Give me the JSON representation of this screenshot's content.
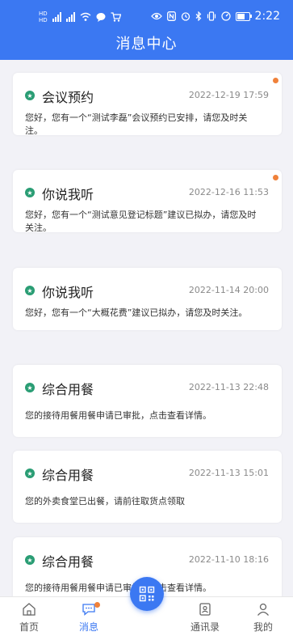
{
  "status": {
    "time": "2:22",
    "left_labels": [
      "HD",
      "HD"
    ],
    "icons": [
      "signal-icon",
      "wifi-icon",
      "message-icon",
      "cart-icon",
      "eye-icon",
      "nfc-icon",
      "alarm-icon",
      "bluetooth-icon",
      "vibrate-icon",
      "speed-icon",
      "battery-icon"
    ]
  },
  "header": {
    "title": "消息中心"
  },
  "messages": [
    {
      "title": "会议预约",
      "date": "2022-12-19 17:59",
      "body": "您好，您有一个“测试李磊”会议预约已安排，请您及时关注。",
      "unread": true
    },
    {
      "title": "你说我听",
      "date": "2022-12-16 11:53",
      "body": "您好，您有一个“测试意见登记标题”建议已拟办，请您及时关注。",
      "unread": true
    },
    {
      "title": "你说我听",
      "date": "2022-11-14 20:00",
      "body": "您好，您有一个“大概花费”建议已拟办，请您及时关注。",
      "unread": false
    },
    {
      "title": "综合用餐",
      "date": "2022-11-13 22:48",
      "body": "您的接待用餐用餐申请已审批，点击查看详情。",
      "unread": false
    },
    {
      "title": "综合用餐",
      "date": "2022-11-13 15:01",
      "body": "您的外卖食堂已出餐，请前往取货点领取",
      "unread": false
    },
    {
      "title": "综合用餐",
      "date": "2022-11-10 18:16",
      "body": "您的接待用餐用餐申请已审批，点击查看详情。",
      "unread": false
    }
  ],
  "tabbar": {
    "home": "首页",
    "messages": "消息",
    "contacts": "通讯录",
    "mine": "我的"
  },
  "colors": {
    "accent": "#3b78f2",
    "badge": "#f0813a",
    "category_icon": "#2a9d74"
  }
}
